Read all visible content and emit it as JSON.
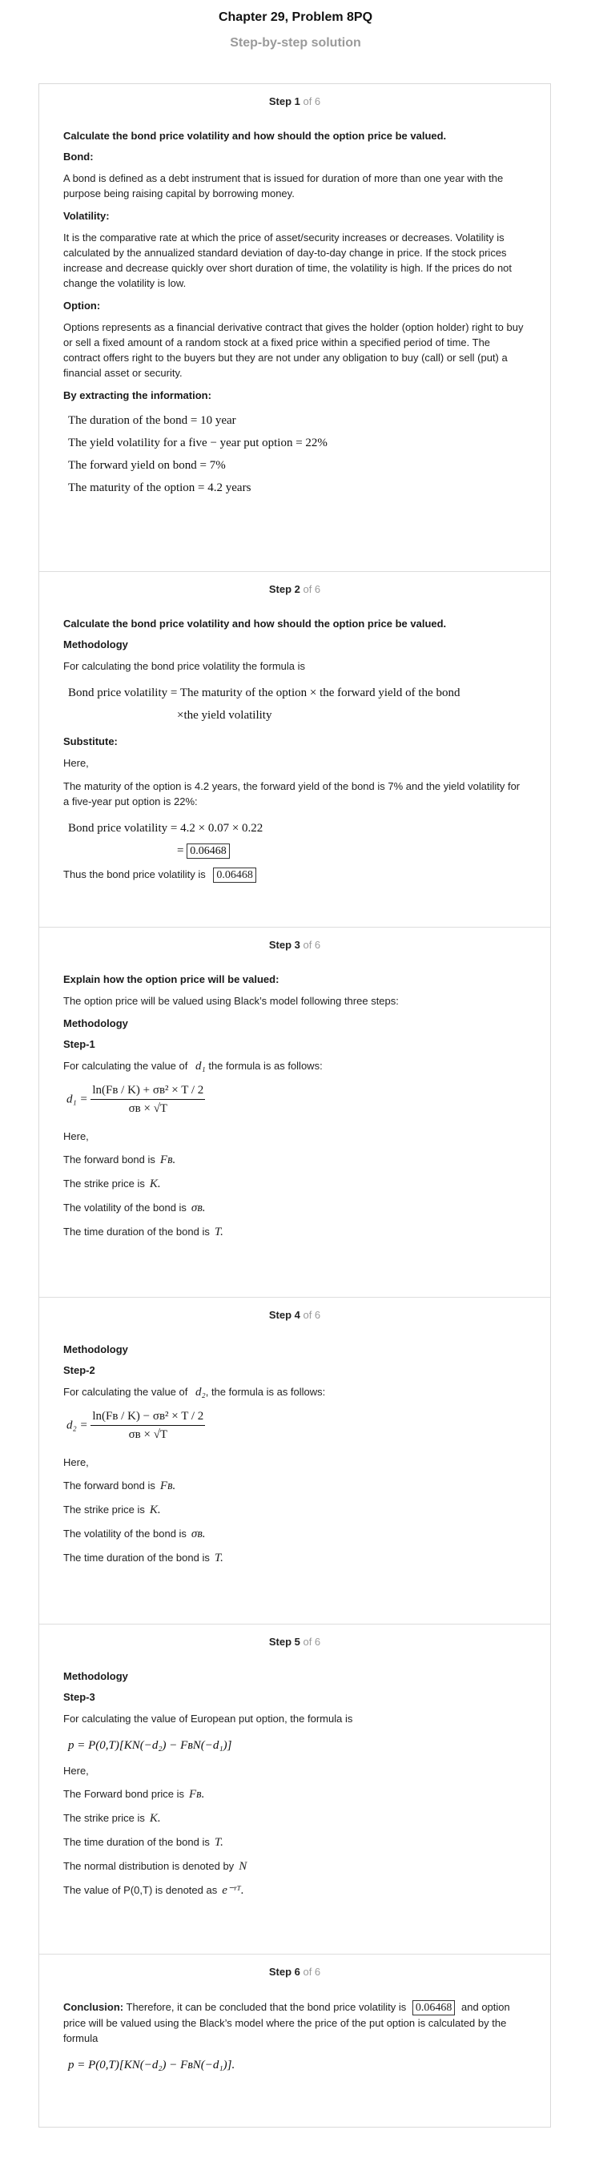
{
  "header": {
    "title": "Chapter 29, Problem 8PQ",
    "subtitle": "Step-by-step solution"
  },
  "steps": [
    {
      "label": "Step 1",
      "of": " of 6",
      "heading": "Calculate the bond price volatility and how should the option price be valued.",
      "bond_h": "Bond:",
      "bond_p": "A bond is defined as a debt instrument that is issued for duration of more than one year with the purpose being raising capital by borrowing money.",
      "vol_h": "Volatility:",
      "vol_p": "It is the comparative rate at which the price of asset/security increases or decreases. Volatility is calculated by the annualized standard deviation of day-to-day change in price. If the stock prices increase and decrease quickly over short duration of time, the volatility is high. If the prices do not change the volatility is low.",
      "opt_h": "Option:",
      "opt_p": "Options represents as a financial derivative contract that gives the holder (option holder) right to buy or sell a fixed amount of a random stock at a fixed price within a specified period of time. The contract offers right to the buyers but they are not under any obligation to buy (call) or sell (put) a financial asset or security.",
      "extract_h": "By extracting the information:",
      "info": [
        "The duration of the bond = 10 year",
        "The yield volatility for a five − year put option = 22%",
        "The forward yield on bond = 7%",
        "The maturity of the option = 4.2 years"
      ]
    },
    {
      "label": "Step 2",
      "of": " of 6",
      "heading": "Calculate the bond price volatility and how should the option price be valued.",
      "method_h": "Methodology",
      "method_p": "For calculating the bond price volatility the formula is",
      "formula_1": "Bond price volatility = The maturity of the option × the forward yield of the bond",
      "formula_2": "×the yield volatility",
      "subst_h": "Substitute:",
      "here": "Here,",
      "subst_p": "The maturity of the option is 4.2 years, the forward yield of the bond is 7% and the yield volatility for a five-year put option is 22%:",
      "calc_1": "Bond price volatility = 4.2 × 0.07 × 0.22",
      "calc_eq": "=",
      "calc_result": "0.06468",
      "thus": "Thus the bond price volatility is",
      "thus_val": "0.06468"
    },
    {
      "label": "Step 3",
      "of": " of 6",
      "heading": "Explain how the option price will be valued:",
      "intro": "The option price will be valued using Black’s model following three steps:",
      "method_h": "Methodology",
      "sub_h": "Step-1",
      "calc_p": "For calculating the value of",
      "calc_sym": "d₁",
      "calc_p2": "the formula is as follows:",
      "here": "Here,",
      "defs": [
        {
          "text": "The forward bond is",
          "sym": "Fʙ."
        },
        {
          "text": "The strike price is",
          "sym": "K."
        },
        {
          "text": "The volatility of the bond is",
          "sym": "σʙ."
        },
        {
          "text": "The time duration of the bond is",
          "sym": "T."
        }
      ]
    },
    {
      "label": "Step 4",
      "of": " of 6",
      "method_h": "Methodology",
      "sub_h": "Step-2",
      "calc_p": "For calculating the value of",
      "calc_sym": "d₂",
      "calc_p2": ", the formula is as follows:",
      "here": "Here,",
      "defs": [
        {
          "text": "The forward bond is",
          "sym": "Fʙ."
        },
        {
          "text": "The strike price is",
          "sym": "K."
        },
        {
          "text": "The volatility of the bond is",
          "sym": "σʙ."
        },
        {
          "text": "The time duration of the bond is",
          "sym": "T."
        }
      ]
    },
    {
      "label": "Step 5",
      "of": " of 6",
      "method_h": "Methodology",
      "sub_h": "Step-3",
      "calc_p": "For calculating the value of European put option, the formula is",
      "formula": "p = P(0,T)[KN(−d₂) − FʙN(−d₁)]",
      "here": "Here,",
      "defs": [
        {
          "text": "The Forward bond price is",
          "sym": "Fʙ."
        },
        {
          "text": "The strike price is",
          "sym": "K."
        },
        {
          "text": "The time duration of the bond is",
          "sym": "T."
        },
        {
          "text": "The normal distribution is denoted by",
          "sym": "N"
        },
        {
          "text": "The value of  P(0,T)  is denoted as",
          "sym": "e⁻ʳᵀ."
        }
      ]
    },
    {
      "label": "Step 6",
      "of": " of 6",
      "concl_h": "Conclusion:",
      "concl_p1": "Therefore, it can be concluded that the bond price volatility is",
      "concl_val": "0.06468",
      "concl_p2": "and option price will be valued using the Black’s model where the price of the put option is calculated by the formula",
      "formula": "p = P(0,T)[KN(−d₂) − FʙN(−d₁)]."
    }
  ],
  "formulas": {
    "d1_lhs": "d₁ =",
    "d1_num": "ln(Fʙ / K) + σʙ² × T / 2",
    "d1_den": "σʙ × √T",
    "d2_lhs": "d₂ =",
    "d2_num": "ln(Fʙ / K) − σʙ² × T / 2",
    "d2_den": "σʙ × √T"
  }
}
